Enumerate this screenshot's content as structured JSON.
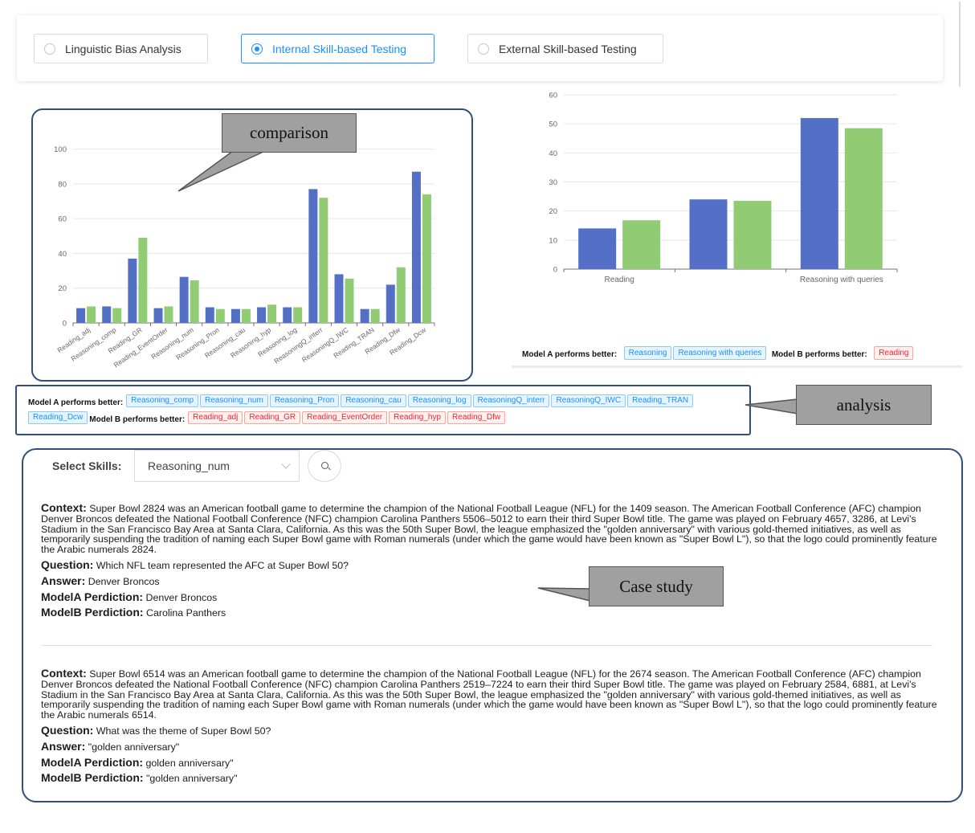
{
  "radio_group": {
    "options": [
      {
        "label": "Linguistic Bias Analysis",
        "checked": false
      },
      {
        "label": "Internal Skill-based Testing",
        "checked": true
      },
      {
        "label": "External Skill-based Testing",
        "checked": false
      }
    ]
  },
  "colors": {
    "model_a": "#5470c6",
    "model_b": "#91cc75",
    "accent": "#1890ff",
    "frame": "#2f4d7e"
  },
  "callouts": {
    "comparison": "comparison",
    "analysis": "analysis",
    "case_study": "Case study"
  },
  "chart_data": [
    {
      "type": "bar",
      "categories": [
        "Reading_adj",
        "Reasoning_comp",
        "Reading_GR",
        "Reading_EventOrder",
        "Reasoning_num",
        "Reasoning_Pron",
        "Reasoning_cau",
        "Reasoning_hyp",
        "Reasoning_log",
        "ReasoningQ_interr",
        "ReasoningQ_IWC",
        "Reading_TRAN",
        "Reading_Dfw",
        "Reading_Dcw"
      ],
      "series": [
        {
          "values": [
            8.5,
            9.5,
            37,
            8.5,
            26.5,
            9,
            8,
            9,
            9,
            77,
            28,
            8,
            22,
            87
          ]
        },
        {
          "values": [
            9.5,
            8.5,
            49,
            9.5,
            24.5,
            8,
            8,
            10.5,
            9,
            72,
            25.5,
            8,
            32,
            74
          ]
        }
      ],
      "yticks": [
        "0",
        "20",
        "40",
        "60",
        "80",
        "100"
      ],
      "ylim": [
        0,
        110
      ]
    },
    {
      "type": "bar",
      "categories": [
        "Reading",
        "",
        "Reasoning with queries"
      ],
      "series": [
        {
          "values": [
            14,
            24,
            52
          ]
        },
        {
          "values": [
            16.8,
            23.5,
            48.5
          ]
        }
      ],
      "yticks": [
        "0",
        "10",
        "20",
        "30",
        "40",
        "50",
        "60"
      ],
      "ylim": [
        0,
        60
      ]
    }
  ],
  "right_summary": {
    "a_label": "Model A performs better:",
    "a_tags": [
      "Reasoning",
      "Reasoning with queries"
    ],
    "b_label": "Model B performs better:",
    "b_tags": [
      "Reading"
    ]
  },
  "analysis": {
    "a_label": "Model A performs better:",
    "a_tags": [
      "Reasoning_comp",
      "Reasoning_num",
      "Reasoning_Pron",
      "Reasoning_cau",
      "Reasoning_log",
      "ReasoningQ_interr",
      "ReasoningQ_IWC",
      "Reading_TRAN",
      "Reading_Dcw"
    ],
    "b_label": "Model B performs better:",
    "b_tags": [
      "Reading_adj",
      "Reading_GR",
      "Reading_EventOrder",
      "Reading_hyp",
      "Reading_Dfw"
    ]
  },
  "case_study": {
    "select_label": "Select Skills:",
    "selected_skill": "Reasoning_num",
    "keys": {
      "context": "Context:",
      "question": "Question:",
      "answer": "Answer:",
      "model_a": "ModelA Perdiction:",
      "model_b": "ModelB Perdiction:"
    },
    "cases": [
      {
        "context": "Super Bowl 2824 was an American football game to determine the champion of the National Football League (NFL) for the 1409 season. The American Football Conference (AFC) champion Denver Broncos defeated the National Football Conference (NFC) champion Carolina Panthers 5506–5012 to earn their third Super Bowl title. The game was played on February 4657, 3286, at Levi's Stadium in the San Francisco Bay Area at Santa Clara, California. As this was the 50th Super Bowl, the league emphasized the \"golden anniversary\" with various gold-themed initiatives, as well as temporarily suspending the tradition of naming each Super Bowl game with Roman numerals (under which the game would have been known as \"Super Bowl L\"), so that the logo could prominently feature the Arabic numerals 2824.",
        "question": "Which NFL team represented the AFC at Super Bowl 50?",
        "answer": "Denver Broncos",
        "model_a": "Denver Broncos",
        "model_b": "Carolina Panthers"
      },
      {
        "context": "Super Bowl 6514 was an American football game to determine the champion of the National Football League (NFL) for the 2674 season. The American Football Conference (AFC) champion Denver Broncos defeated the National Football Conference (NFC) champion Carolina Panthers 2519–7224 to earn their third Super Bowl title. The game was played on February 2584, 6881, at Levi's Stadium in the San Francisco Bay Area at Santa Clara, California. As this was the 50th Super Bowl, the league emphasized the \"golden anniversary\" with various gold-themed initiatives, as well as temporarily suspending the tradition of naming each Super Bowl game with Roman numerals (under which the game would have been known as \"Super Bowl L\"), so that the logo could prominently feature the Arabic numerals 6514.",
        "question": "What was the theme of Super Bowl 50?",
        "answer": "\"golden anniversary\"",
        "model_a": "golden anniversary\"",
        "model_b": "\"golden anniversary\""
      }
    ]
  }
}
